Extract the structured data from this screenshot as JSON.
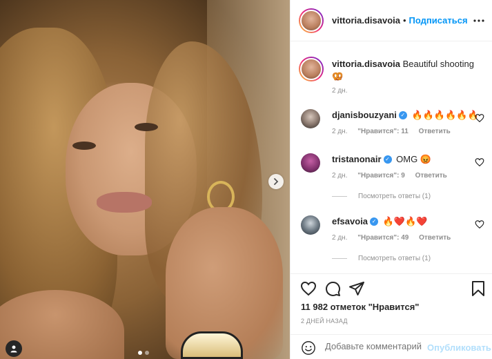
{
  "post": {
    "author": "vittoria.disavoia",
    "follow_label": "Подписаться",
    "dot": "•",
    "more": "•••",
    "caption_text": "Beautiful shooting",
    "caption_emoji": "🥨",
    "caption_time": "2 дн."
  },
  "comments": [
    {
      "user": "djanisbouzyani",
      "verified": true,
      "text": "🔥🔥🔥🔥🔥🔥",
      "time": "2 дн.",
      "likes": "\"Нравится\": 11",
      "reply": "Ответить",
      "replies": ""
    },
    {
      "user": "tristanonair",
      "verified": true,
      "text": "OMG 😡",
      "time": "2 дн.",
      "likes": "\"Нравится\": 9",
      "reply": "Ответить",
      "replies": "Посмотреть ответы (1)"
    },
    {
      "user": "efsavoia",
      "verified": true,
      "text": "🔥❤️🔥❤️",
      "time": "2 дн.",
      "likes": "\"Нравится\": 49",
      "reply": "Ответить",
      "replies": "Посмотреть ответы (1)"
    }
  ],
  "actions": {
    "likes_text": "11 982 отметок \"Нравится\"",
    "date_text": "2 ДНЕЙ НАЗАД"
  },
  "add_comment": {
    "placeholder": "Добавьте комментарий...",
    "post_label": "Опубликовать"
  },
  "carousel": {
    "total_slides": 2,
    "current_slide": 1
  },
  "colors": {
    "accent": "#0095f6",
    "verified": "#3897f0",
    "muted": "#8e8e8e",
    "text": "#262626"
  },
  "icons": [
    "chevron-right-icon",
    "user-tag-icon",
    "more-icon",
    "verified-icon",
    "heart-icon",
    "comment-icon",
    "share-icon",
    "bookmark-icon",
    "emoji-icon"
  ]
}
